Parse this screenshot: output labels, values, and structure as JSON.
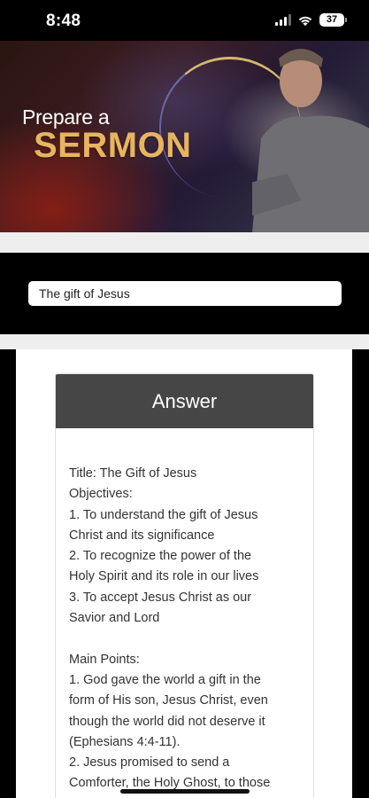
{
  "status_bar": {
    "time": "8:48",
    "battery": "37"
  },
  "hero": {
    "line1": "Prepare a",
    "line2": "SERMON",
    "accent_color": "#e7b560"
  },
  "search": {
    "value": "The gift of Jesus"
  },
  "answer": {
    "header": "Answer",
    "lines": [
      "Title: The Gift of Jesus",
      "Objectives:",
      "1. To understand the gift of Jesus",
      "Christ and its significance",
      "2. To recognize the power of the",
      "Holy Spirit and its role in our lives",
      "3. To accept Jesus Christ as our",
      "Savior and Lord",
      "",
      "Main Points:",
      "1. God gave the world a gift in the",
      "form of His son, Jesus Christ, even",
      "though the world did not deserve it",
      "(Ephesians 4:4-11).",
      "2. Jesus promised to send a",
      "Comforter, the Holy Ghost, to those"
    ]
  }
}
